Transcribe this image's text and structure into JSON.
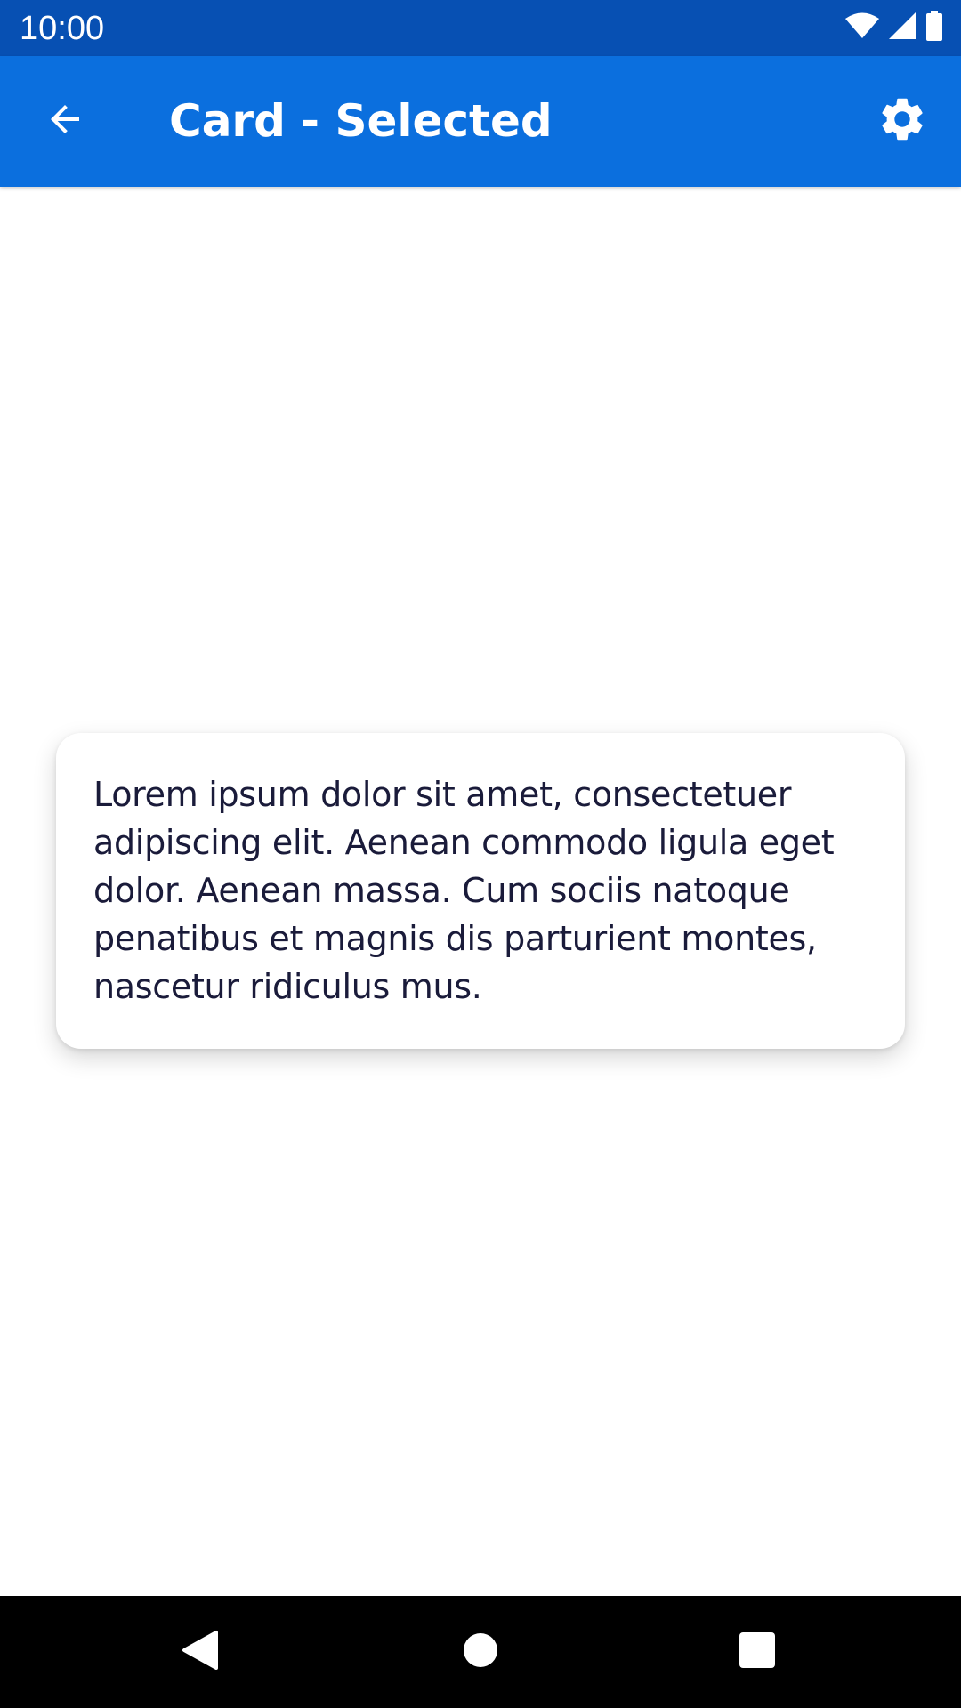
{
  "status_bar": {
    "time": "10:00",
    "icons": [
      "wifi-icon",
      "cellular-signal-icon",
      "battery-icon"
    ]
  },
  "app_bar": {
    "title": "Card - Selected",
    "back_icon": "arrow-back-icon",
    "settings_icon": "gear-icon",
    "background_color": "#0b6fde"
  },
  "card": {
    "text": "Lorem ipsum dolor sit amet, consectetuer adipiscing elit. Aenean commodo ligula eget dolor. Aenean massa. Cum sociis natoque penatibus et magnis dis parturient montes, nascetur ridiculus mus."
  },
  "nav_bar": {
    "buttons": [
      "back-triangle-icon",
      "home-circle-icon",
      "recents-square-icon"
    ]
  },
  "colors": {
    "status_bar": "#0750b3",
    "app_bar": "#0b6fde",
    "card_text": "#1a1b3a",
    "nav_bar": "#000000"
  }
}
